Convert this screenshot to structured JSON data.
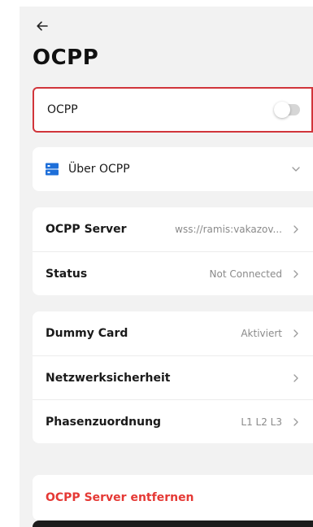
{
  "header": {
    "back_icon": "arrow-left-icon",
    "title": "OCPP"
  },
  "toggle": {
    "label": "OCPP",
    "enabled": false
  },
  "about": {
    "icon": "server-icon",
    "label": "Über OCPP",
    "icon_color": "#1e6fd9"
  },
  "server_group": [
    {
      "label": "OCPP Server",
      "value": "wss://ramis:vakazov..."
    },
    {
      "label": "Status",
      "value": "Not Connected"
    }
  ],
  "settings_group": [
    {
      "label": "Dummy Card",
      "value": "Aktiviert"
    },
    {
      "label": "Netzwerksicherheit",
      "value": ""
    },
    {
      "label": "Phasenzuordnung",
      "value": "L1 L2 L3"
    }
  ],
  "remove": {
    "label": "OCPP Server entfernen",
    "color": "#e53935"
  }
}
